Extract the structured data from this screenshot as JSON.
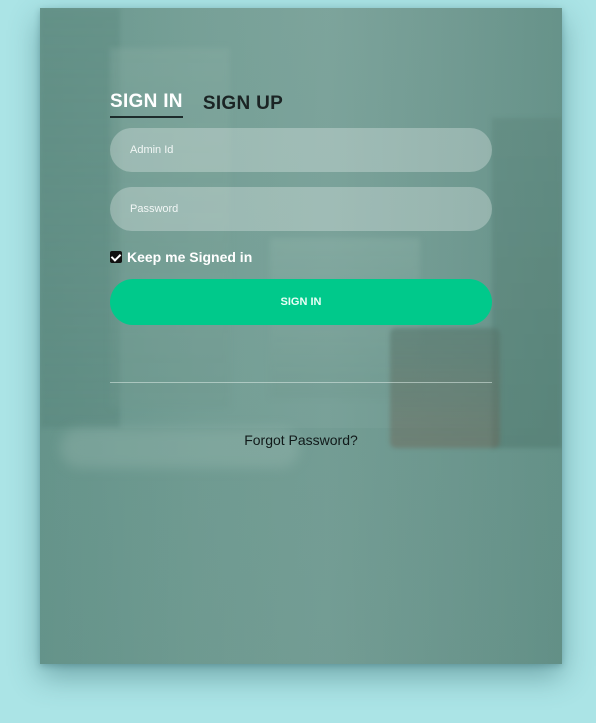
{
  "auth": {
    "tabs": [
      {
        "label": "SIGN IN",
        "active": true
      },
      {
        "label": "SIGN UP",
        "active": false
      }
    ],
    "fields": {
      "admin_id_placeholder": "Admin Id",
      "password_placeholder": "Password"
    },
    "remember": {
      "label": "Keep me Signed in",
      "checked": true
    },
    "submit_label": "SIGN IN",
    "forgot_link": "Forgot Password?"
  },
  "colors": {
    "accent": "#00c98b",
    "page_background": "#abe4e6",
    "card_tint": "#7fa69d"
  }
}
